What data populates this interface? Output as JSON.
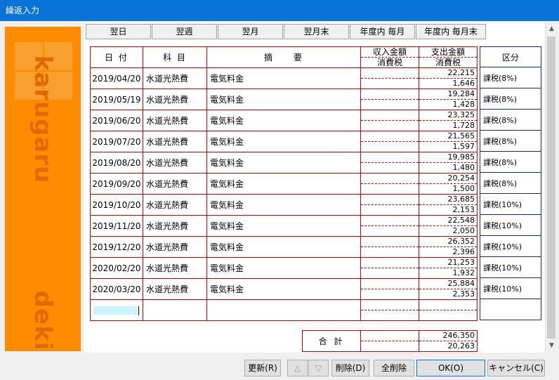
{
  "window": {
    "title": "繰返入力"
  },
  "brand": {
    "top_text": "karugaru",
    "bottom_text": "dekiru"
  },
  "tabs": [
    "翌日",
    "翌週",
    "翌月",
    "翌月末",
    "年度内 毎月",
    "年度内 毎月末"
  ],
  "headers": {
    "date": "日 付",
    "account": "科 目",
    "desc": "摘　　要",
    "income_top": "収入金額",
    "income_bot": "消費税",
    "expense_top": "支出金額",
    "expense_bot": "消費税",
    "kubun": "区分"
  },
  "rows": [
    {
      "date": "2019/04/20",
      "account": "水道光熱費",
      "desc": "電気料金",
      "expense": "22,215",
      "tax": "1,646",
      "kubun": "課税(8%)"
    },
    {
      "date": "2019/05/19",
      "account": "水道光熱費",
      "desc": "電気料金",
      "expense": "19,284",
      "tax": "1,428",
      "kubun": "課税(8%)"
    },
    {
      "date": "2019/06/20",
      "account": "水道光熱費",
      "desc": "電気料金",
      "expense": "23,325",
      "tax": "1,728",
      "kubun": "課税(8%)"
    },
    {
      "date": "2019/07/20",
      "account": "水道光熱費",
      "desc": "電気料金",
      "expense": "21,565",
      "tax": "1,597",
      "kubun": "課税(8%)"
    },
    {
      "date": "2019/08/20",
      "account": "水道光熱費",
      "desc": "電気料金",
      "expense": "19,985",
      "tax": "1,480",
      "kubun": "課税(8%)"
    },
    {
      "date": "2019/09/20",
      "account": "水道光熱費",
      "desc": "電気料金",
      "expense": "20,254",
      "tax": "1,500",
      "kubun": "課税(8%)"
    },
    {
      "date": "2019/10/20",
      "account": "水道光熱費",
      "desc": "電気料金",
      "expense": "23,685",
      "tax": "2,153",
      "kubun": "課税(10%)"
    },
    {
      "date": "2019/11/20",
      "account": "水道光熱費",
      "desc": "電気料金",
      "expense": "22,548",
      "tax": "2,050",
      "kubun": "課税(10%)"
    },
    {
      "date": "2019/12/20",
      "account": "水道光熱費",
      "desc": "電気料金",
      "expense": "26,352",
      "tax": "2,396",
      "kubun": "課税(10%)"
    },
    {
      "date": "2020/02/20",
      "account": "水道光熱費",
      "desc": "電気料金",
      "expense": "21,253",
      "tax": "1,932",
      "kubun": "課税(10%)"
    },
    {
      "date": "2020/03/20",
      "account": "水道光熱費",
      "desc": "電気料金",
      "expense": "25,884",
      "tax": "2,353",
      "kubun": "課税(10%)"
    }
  ],
  "totals": {
    "label": "合 計",
    "expense": "246,350",
    "tax": "20,263"
  },
  "buttons": {
    "update": "更新(R)",
    "up": "△",
    "down": "▽",
    "delete": "削除(D)",
    "delete_all": "全削除",
    "ok": "OK(O)",
    "cancel": "キャンセル(C)"
  },
  "scroll": {
    "up_icon": "scroll-up-arrow",
    "down_icon": "scroll-down-arrow"
  }
}
